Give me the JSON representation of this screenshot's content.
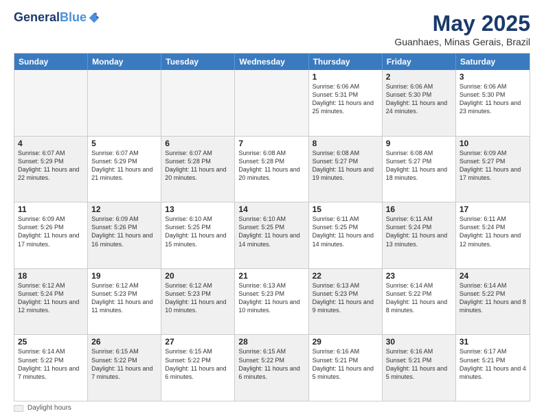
{
  "logo": {
    "line1": "General",
    "line2": "Blue"
  },
  "title": "May 2025",
  "location": "Guanhaes, Minas Gerais, Brazil",
  "weekdays": [
    "Sunday",
    "Monday",
    "Tuesday",
    "Wednesday",
    "Thursday",
    "Friday",
    "Saturday"
  ],
  "rows": [
    [
      {
        "day": "",
        "text": "",
        "empty": true
      },
      {
        "day": "",
        "text": "",
        "empty": true
      },
      {
        "day": "",
        "text": "",
        "empty": true
      },
      {
        "day": "",
        "text": "",
        "empty": true
      },
      {
        "day": "1",
        "text": "Sunrise: 6:06 AM\nSunset: 5:31 PM\nDaylight: 11 hours and 25 minutes."
      },
      {
        "day": "2",
        "text": "Sunrise: 6:06 AM\nSunset: 5:30 PM\nDaylight: 11 hours and 24 minutes.",
        "shaded": true
      },
      {
        "day": "3",
        "text": "Sunrise: 6:06 AM\nSunset: 5:30 PM\nDaylight: 11 hours and 23 minutes."
      }
    ],
    [
      {
        "day": "4",
        "text": "Sunrise: 6:07 AM\nSunset: 5:29 PM\nDaylight: 11 hours and 22 minutes.",
        "shaded": true
      },
      {
        "day": "5",
        "text": "Sunrise: 6:07 AM\nSunset: 5:29 PM\nDaylight: 11 hours and 21 minutes."
      },
      {
        "day": "6",
        "text": "Sunrise: 6:07 AM\nSunset: 5:28 PM\nDaylight: 11 hours and 20 minutes.",
        "shaded": true
      },
      {
        "day": "7",
        "text": "Sunrise: 6:08 AM\nSunset: 5:28 PM\nDaylight: 11 hours and 20 minutes."
      },
      {
        "day": "8",
        "text": "Sunrise: 6:08 AM\nSunset: 5:27 PM\nDaylight: 11 hours and 19 minutes.",
        "shaded": true
      },
      {
        "day": "9",
        "text": "Sunrise: 6:08 AM\nSunset: 5:27 PM\nDaylight: 11 hours and 18 minutes."
      },
      {
        "day": "10",
        "text": "Sunrise: 6:09 AM\nSunset: 5:27 PM\nDaylight: 11 hours and 17 minutes.",
        "shaded": true
      }
    ],
    [
      {
        "day": "11",
        "text": "Sunrise: 6:09 AM\nSunset: 5:26 PM\nDaylight: 11 hours and 17 minutes."
      },
      {
        "day": "12",
        "text": "Sunrise: 6:09 AM\nSunset: 5:26 PM\nDaylight: 11 hours and 16 minutes.",
        "shaded": true
      },
      {
        "day": "13",
        "text": "Sunrise: 6:10 AM\nSunset: 5:25 PM\nDaylight: 11 hours and 15 minutes."
      },
      {
        "day": "14",
        "text": "Sunrise: 6:10 AM\nSunset: 5:25 PM\nDaylight: 11 hours and 14 minutes.",
        "shaded": true
      },
      {
        "day": "15",
        "text": "Sunrise: 6:11 AM\nSunset: 5:25 PM\nDaylight: 11 hours and 14 minutes."
      },
      {
        "day": "16",
        "text": "Sunrise: 6:11 AM\nSunset: 5:24 PM\nDaylight: 11 hours and 13 minutes.",
        "shaded": true
      },
      {
        "day": "17",
        "text": "Sunrise: 6:11 AM\nSunset: 5:24 PM\nDaylight: 11 hours and 12 minutes."
      }
    ],
    [
      {
        "day": "18",
        "text": "Sunrise: 6:12 AM\nSunset: 5:24 PM\nDaylight: 11 hours and 12 minutes.",
        "shaded": true
      },
      {
        "day": "19",
        "text": "Sunrise: 6:12 AM\nSunset: 5:23 PM\nDaylight: 11 hours and 11 minutes."
      },
      {
        "day": "20",
        "text": "Sunrise: 6:12 AM\nSunset: 5:23 PM\nDaylight: 11 hours and 10 minutes.",
        "shaded": true
      },
      {
        "day": "21",
        "text": "Sunrise: 6:13 AM\nSunset: 5:23 PM\nDaylight: 11 hours and 10 minutes."
      },
      {
        "day": "22",
        "text": "Sunrise: 6:13 AM\nSunset: 5:23 PM\nDaylight: 11 hours and 9 minutes.",
        "shaded": true
      },
      {
        "day": "23",
        "text": "Sunrise: 6:14 AM\nSunset: 5:22 PM\nDaylight: 11 hours and 8 minutes."
      },
      {
        "day": "24",
        "text": "Sunrise: 6:14 AM\nSunset: 5:22 PM\nDaylight: 11 hours and 8 minutes.",
        "shaded": true
      }
    ],
    [
      {
        "day": "25",
        "text": "Sunrise: 6:14 AM\nSunset: 5:22 PM\nDaylight: 11 hours and 7 minutes."
      },
      {
        "day": "26",
        "text": "Sunrise: 6:15 AM\nSunset: 5:22 PM\nDaylight: 11 hours and 7 minutes.",
        "shaded": true
      },
      {
        "day": "27",
        "text": "Sunrise: 6:15 AM\nSunset: 5:22 PM\nDaylight: 11 hours and 6 minutes."
      },
      {
        "day": "28",
        "text": "Sunrise: 6:15 AM\nSunset: 5:22 PM\nDaylight: 11 hours and 6 minutes.",
        "shaded": true
      },
      {
        "day": "29",
        "text": "Sunrise: 6:16 AM\nSunset: 5:21 PM\nDaylight: 11 hours and 5 minutes."
      },
      {
        "day": "30",
        "text": "Sunrise: 6:16 AM\nSunset: 5:21 PM\nDaylight: 11 hours and 5 minutes.",
        "shaded": true
      },
      {
        "day": "31",
        "text": "Sunrise: 6:17 AM\nSunset: 5:21 PM\nDaylight: 11 hours and 4 minutes."
      }
    ]
  ],
  "legend": {
    "daylight_label": "Daylight hours"
  }
}
